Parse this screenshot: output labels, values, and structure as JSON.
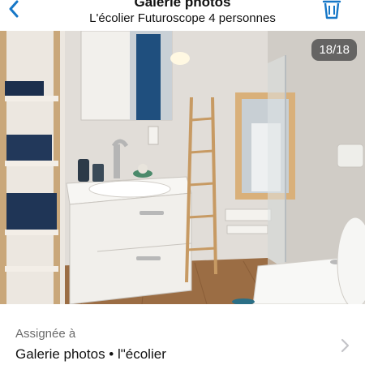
{
  "header": {
    "title": "Galerie photos",
    "subtitle": "L'écolier Futuroscope 4 personnes",
    "back_icon": "chevron-left-icon",
    "delete_icon": "trash-icon",
    "accent_color": "#1677c7"
  },
  "photo": {
    "counter": "18/18"
  },
  "footer": {
    "assigned_label": "Assignée à",
    "assigned_value": "Galerie photos • l\"écolier",
    "chevron_icon": "chevron-right-icon"
  }
}
